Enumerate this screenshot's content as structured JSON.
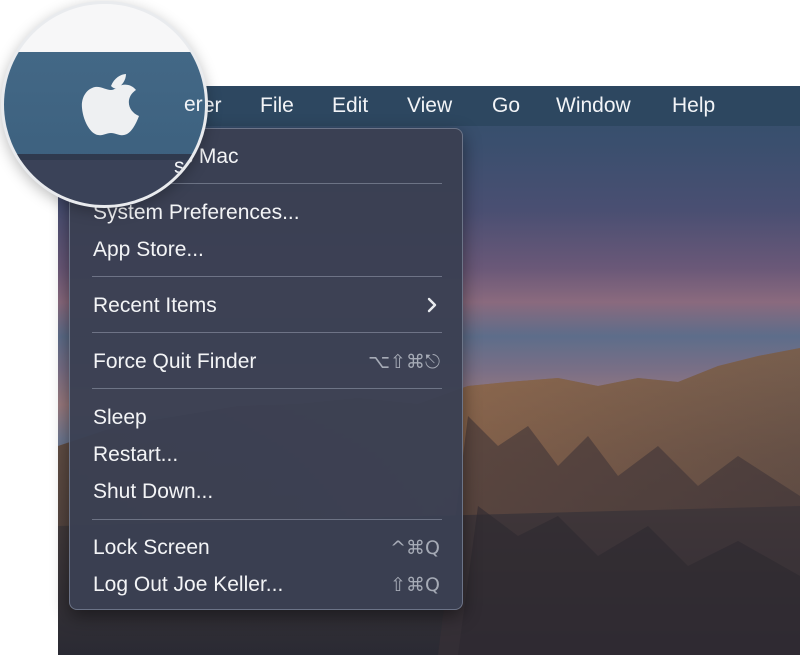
{
  "menubar": {
    "items": [
      {
        "label": "Finder"
      },
      {
        "label": "File"
      },
      {
        "label": "Edit"
      },
      {
        "label": "View"
      },
      {
        "label": "Go"
      },
      {
        "label": "Window"
      },
      {
        "label": "Help"
      }
    ]
  },
  "apple_menu": {
    "items": [
      {
        "label": "About This Mac",
        "shortcut": ""
      },
      {
        "label": "System Preferences...",
        "shortcut": ""
      },
      {
        "label": "App Store...",
        "shortcut": ""
      },
      {
        "label": "Recent Items",
        "submenu_icon": "chevron-right-icon"
      },
      {
        "label": "Force Quit Finder",
        "shortcut": "⌥⇧⌘⎋"
      },
      {
        "label": "Sleep",
        "shortcut": ""
      },
      {
        "label": "Restart...",
        "shortcut": ""
      },
      {
        "label": "Shut Down...",
        "shortcut": ""
      },
      {
        "label": "Lock Screen",
        "shortcut": "^⌘Q"
      },
      {
        "label": "Log Out Joe Keller...",
        "shortcut": "⇧⌘Q"
      }
    ]
  },
  "magnifier": {
    "icon": "apple-logo-icon",
    "partial_menubar_text": "er",
    "partial_menu_text": "s Mac"
  },
  "colors": {
    "menubar": "#2c4660",
    "menu_background": "#3a4052",
    "menu_text": "#f3f4f6",
    "shortcut_text": "#a6abb6"
  }
}
